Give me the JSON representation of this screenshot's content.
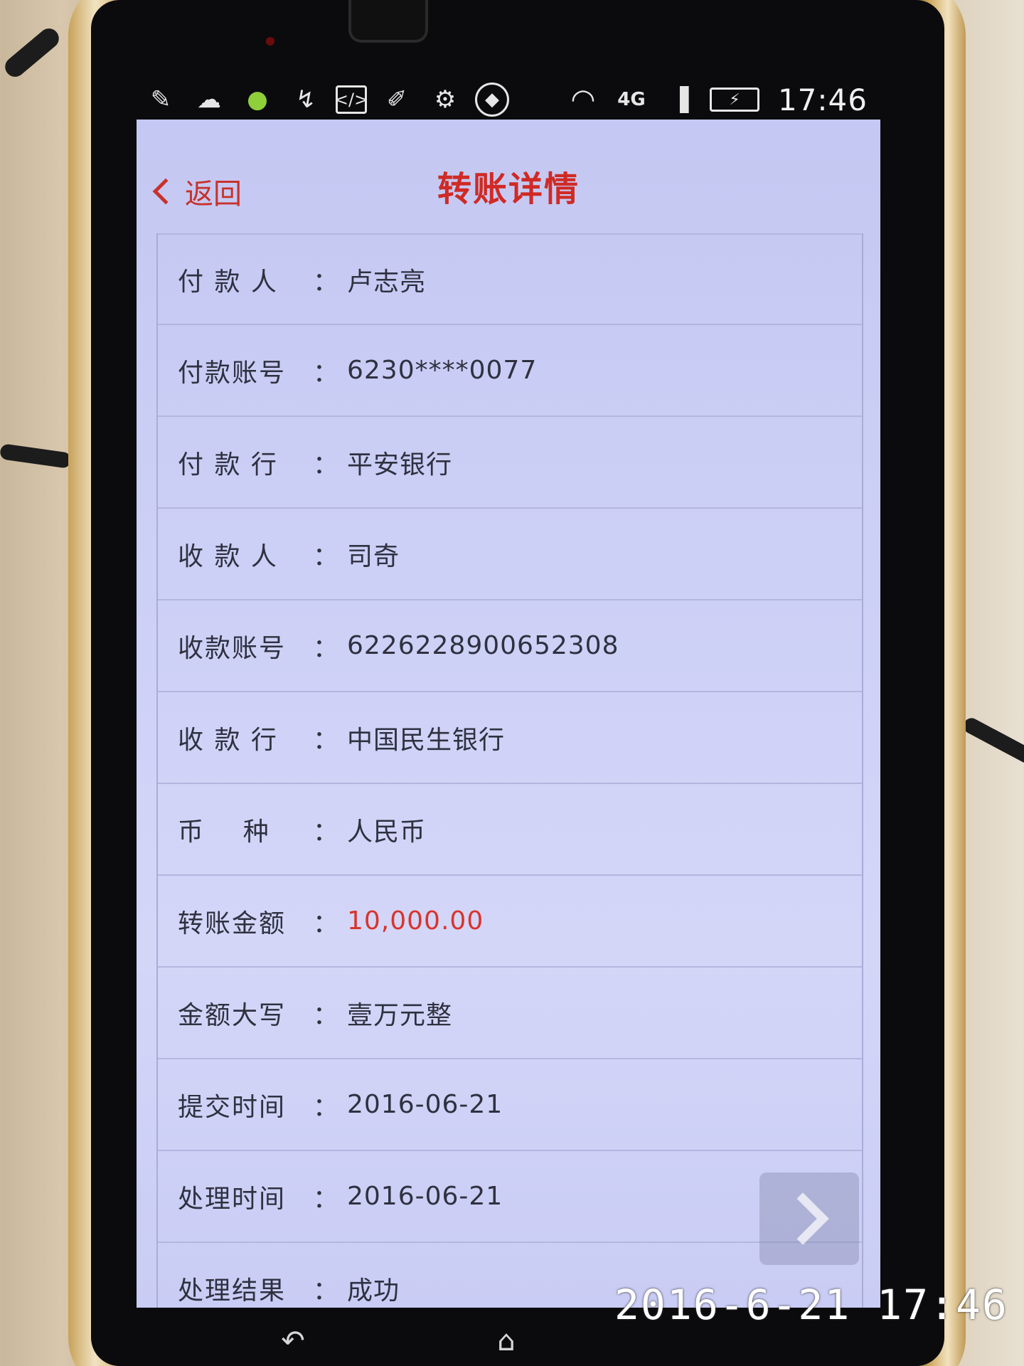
{
  "status_bar": {
    "icons": [
      "leaf-icon",
      "weather-icon",
      "app-notification-icon",
      "usb-icon",
      "code-icon",
      "cleaner-icon",
      "security-gear-icon",
      "shield-icon",
      "wifi-icon",
      "4g-icon",
      "signal-icon",
      "battery-charging-icon"
    ],
    "network_label": "4G",
    "time": "17:46"
  },
  "header": {
    "back_label": "返回",
    "title": "转账详情"
  },
  "details": [
    {
      "label": "付 款 人",
      "value": "卢志亮"
    },
    {
      "label": "付款账号",
      "value": "6230****0077"
    },
    {
      "label": "付 款 行",
      "value": "平安银行"
    },
    {
      "label": "收 款 人",
      "value": "司奇"
    },
    {
      "label": "收款账号",
      "value": "6226228900652308"
    },
    {
      "label": "收 款 行",
      "value": "中国民生银行"
    },
    {
      "label": "币    种",
      "value": "人民币"
    },
    {
      "label": "转账金额",
      "value": "10,000.00"
    },
    {
      "label": "金额大写",
      "value": "壹万元整"
    },
    {
      "label": "提交时间",
      "value": "2016-06-21"
    },
    {
      "label": "处理时间",
      "value": "2016-06-21"
    },
    {
      "label": "处理结果",
      "value": "成功"
    }
  ],
  "colon": "：",
  "colors": {
    "accent_red": "#d02a24",
    "screen_bg": "#cdd0f6",
    "text": "#2f3140"
  },
  "photo_stamp": "2016-6-21 17:46"
}
